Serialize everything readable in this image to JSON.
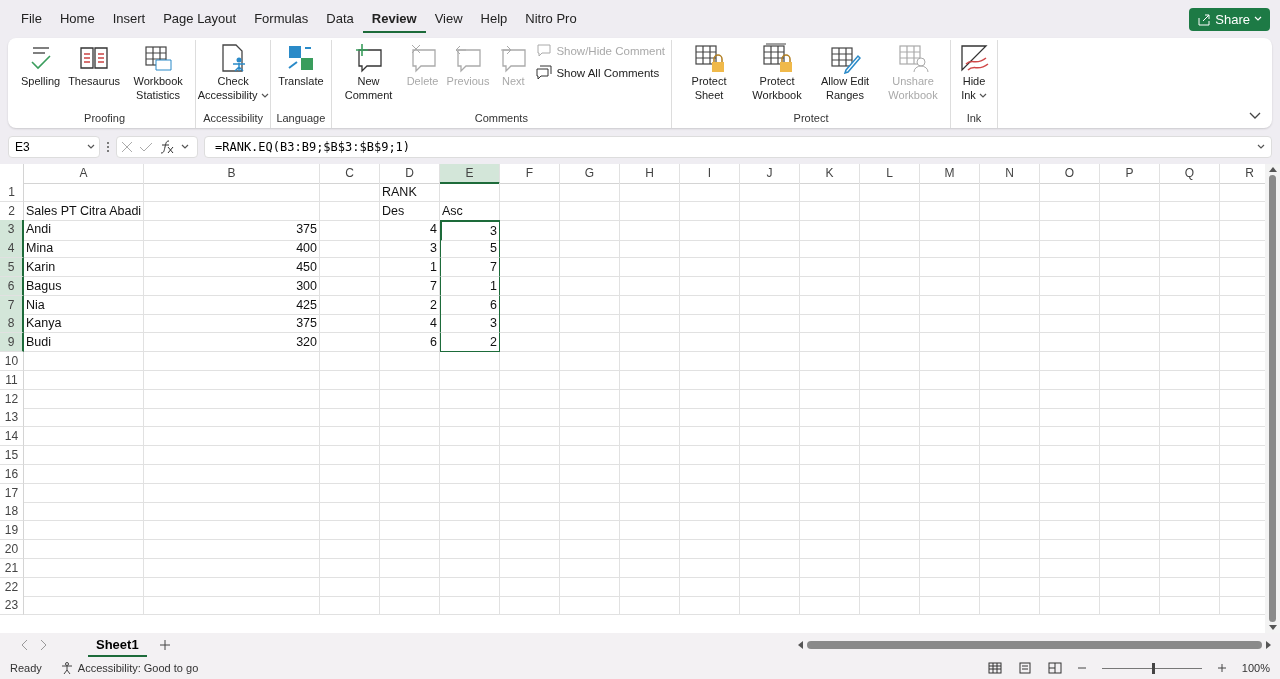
{
  "menu_tabs": [
    {
      "label": "File",
      "selected": false
    },
    {
      "label": "Home",
      "selected": false
    },
    {
      "label": "Insert",
      "selected": false
    },
    {
      "label": "Page Layout",
      "selected": false
    },
    {
      "label": "Formulas",
      "selected": false
    },
    {
      "label": "Data",
      "selected": false
    },
    {
      "label": "Review",
      "selected": true
    },
    {
      "label": "View",
      "selected": false
    },
    {
      "label": "Help",
      "selected": false
    },
    {
      "label": "Nitro Pro",
      "selected": false
    }
  ],
  "share_button": {
    "label": "Share"
  },
  "ribbon_groups": [
    {
      "label": "Proofing",
      "buttons": [
        {
          "kind": "large",
          "label": "Spelling",
          "disabled": false
        },
        {
          "kind": "large",
          "label": "Thesaurus",
          "disabled": false
        },
        {
          "kind": "large",
          "label": "Workbook Statistics",
          "disabled": false
        }
      ]
    },
    {
      "label": "Accessibility",
      "buttons": [
        {
          "kind": "dropdown",
          "label": "Check Accessibility",
          "disabled": false
        }
      ]
    },
    {
      "label": "Language",
      "buttons": [
        {
          "kind": "large",
          "label": "Translate",
          "disabled": false
        }
      ]
    },
    {
      "label": "Comments",
      "buttons": [
        {
          "kind": "large",
          "label": "New Comment",
          "disabled": false
        },
        {
          "kind": "large",
          "label": "Delete",
          "disabled": true
        },
        {
          "kind": "large",
          "label": "Previous",
          "disabled": true
        },
        {
          "kind": "large",
          "label": "Next",
          "disabled": true
        },
        {
          "kind": "small",
          "label": "Show/Hide Comment",
          "disabled": true
        },
        {
          "kind": "small",
          "label": "Show All Comments",
          "disabled": false
        }
      ]
    },
    {
      "label": "Protect",
      "buttons": [
        {
          "kind": "large",
          "label": "Protect Sheet",
          "disabled": false
        },
        {
          "kind": "large",
          "label": "Protect Workbook",
          "disabled": false
        },
        {
          "kind": "large",
          "label": "Allow Edit Ranges",
          "disabled": false
        },
        {
          "kind": "large",
          "label": "Unshare Workbook",
          "disabled": true
        }
      ]
    },
    {
      "label": "Ink",
      "buttons": [
        {
          "kind": "dropdown",
          "label": "Hide Ink",
          "disabled": false
        }
      ]
    }
  ],
  "formula_bar": {
    "name_box": "E3",
    "formula": "=RANK.EQ(B3:B9;$B$3:$B$9;1)"
  },
  "grid": {
    "columns": [
      {
        "label": "A",
        "selected": false
      },
      {
        "label": "B",
        "selected": false
      },
      {
        "label": "C",
        "selected": false
      },
      {
        "label": "D",
        "selected": false
      },
      {
        "label": "E",
        "selected": true
      },
      {
        "label": "F",
        "selected": false
      },
      {
        "label": "G",
        "selected": false
      },
      {
        "label": "H",
        "selected": false
      },
      {
        "label": "I",
        "selected": false
      },
      {
        "label": "J",
        "selected": false
      },
      {
        "label": "K",
        "selected": false
      },
      {
        "label": "L",
        "selected": false
      },
      {
        "label": "M",
        "selected": false
      },
      {
        "label": "N",
        "selected": false
      },
      {
        "label": "O",
        "selected": false
      },
      {
        "label": "P",
        "selected": false
      },
      {
        "label": "Q",
        "selected": false
      },
      {
        "label": "R",
        "selected": false
      }
    ],
    "rows": [
      {
        "label": "1",
        "kind": "label",
        "selected": false,
        "cells": {
          "D": "RANK"
        }
      },
      {
        "label": "2",
        "kind": "label",
        "selected": false,
        "cells": {
          "A": "Sales PT Citra Abadi",
          "D": "Des",
          "E": "Asc"
        }
      },
      {
        "label": "3",
        "kind": "data",
        "selected": true,
        "cells": {
          "A": "Andi",
          "B": "375",
          "D": "4",
          "E": "3"
        }
      },
      {
        "label": "4",
        "kind": "data",
        "selected": true,
        "cells": {
          "A": "Mina",
          "B": "400",
          "D": "3",
          "E": "5"
        }
      },
      {
        "label": "5",
        "kind": "data",
        "selected": true,
        "cells": {
          "A": "Karin",
          "B": "450",
          "D": "1",
          "E": "7"
        }
      },
      {
        "label": "6",
        "kind": "data",
        "selected": true,
        "cells": {
          "A": "Bagus",
          "B": "300",
          "D": "7",
          "E": "1"
        }
      },
      {
        "label": "7",
        "kind": "data",
        "selected": true,
        "cells": {
          "A": "Nia",
          "B": "425",
          "D": "2",
          "E": "6"
        }
      },
      {
        "label": "8",
        "kind": "data",
        "selected": true,
        "cells": {
          "A": "Kanya",
          "B": "375",
          "D": "4",
          "E": "3"
        }
      },
      {
        "label": "9",
        "kind": "data",
        "selected": true,
        "cells": {
          "A": "Budi",
          "B": "320",
          "D": "6",
          "E": "2"
        }
      },
      {
        "label": "10",
        "kind": "empty",
        "selected": false
      },
      {
        "label": "11",
        "kind": "empty",
        "selected": false
      },
      {
        "label": "12",
        "kind": "empty",
        "selected": false
      },
      {
        "label": "13",
        "kind": "empty",
        "selected": false
      },
      {
        "label": "14",
        "kind": "empty",
        "selected": false
      },
      {
        "label": "15",
        "kind": "empty",
        "selected": false
      },
      {
        "label": "16",
        "kind": "empty",
        "selected": false
      },
      {
        "label": "17",
        "kind": "empty",
        "selected": false
      },
      {
        "label": "18",
        "kind": "empty",
        "selected": false
      },
      {
        "label": "19",
        "kind": "empty",
        "selected": false
      },
      {
        "label": "20",
        "kind": "empty",
        "selected": false
      },
      {
        "label": "21",
        "kind": "empty",
        "selected": false
      },
      {
        "label": "22",
        "kind": "empty",
        "selected": false
      },
      {
        "label": "23",
        "kind": "empty",
        "selected": false
      }
    ]
  },
  "sheet_tabs": [
    {
      "label": "Sheet1",
      "selected": true
    }
  ],
  "status_bar": {
    "status": "Ready",
    "accessibility": "Accessibility: Good to go",
    "zoom": {
      "level": 0.5,
      "reading": "100%"
    }
  }
}
